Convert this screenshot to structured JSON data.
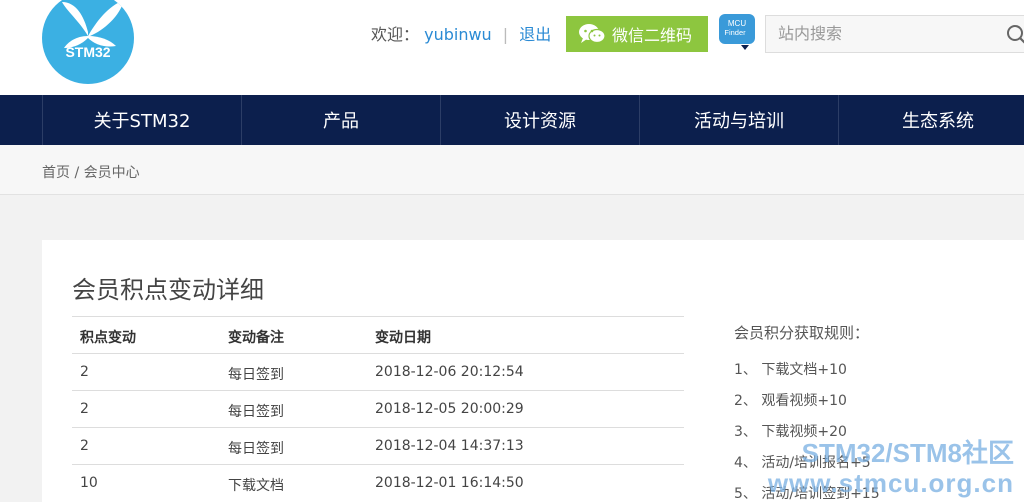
{
  "header": {
    "logo_text": "STM32",
    "welcome_label": "欢迎：",
    "username": "yubinwu",
    "separator": "|",
    "logout_label": "退出",
    "wechat_label": "微信二维码",
    "mcu_finder_line1": "MCU",
    "mcu_finder_line2": "Finder",
    "search_placeholder": "站内搜索"
  },
  "nav": {
    "items": [
      {
        "label": "关于STM32"
      },
      {
        "label": "产品"
      },
      {
        "label": "设计资源"
      },
      {
        "label": "活动与培训"
      },
      {
        "label": "生态系统"
      }
    ]
  },
  "breadcrumb": {
    "home": "首页",
    "separator": "/",
    "current": "会员中心"
  },
  "main": {
    "title": "会员积点变动详细",
    "table": {
      "headers": [
        "积点变动",
        "变动备注",
        "变动日期"
      ],
      "rows": [
        [
          "2",
          "每日签到",
          "2018-12-06 20:12:54"
        ],
        [
          "2",
          "每日签到",
          "2018-12-05 20:00:29"
        ],
        [
          "2",
          "每日签到",
          "2018-12-04 14:37:13"
        ],
        [
          "10",
          "下载文档",
          "2018-12-01 16:14:50"
        ]
      ]
    },
    "rules": {
      "title": "会员积分获取规则：",
      "items": [
        "1、 下载文档+10",
        "2、 观看视频+10",
        "3、 下载视频+20",
        "4、 活动/培训报名+5",
        "5、 活动/培训签到+15"
      ]
    }
  },
  "watermark": {
    "line1": "STM32/STM8社区",
    "line2": "www.stmcu.org.cn"
  },
  "colors": {
    "nav_bg": "#0c1f4d",
    "logo_bg": "#3bb0e3",
    "wechat_bg": "#8dc63f",
    "link": "#2a8ad4"
  }
}
